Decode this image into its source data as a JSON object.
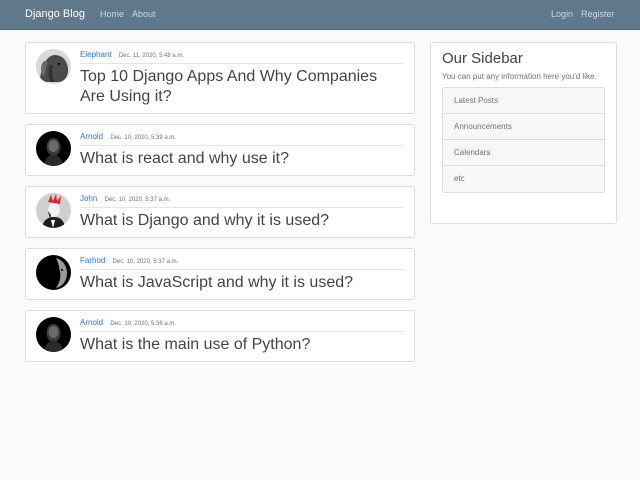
{
  "navbar": {
    "brand": "Django Blog",
    "links": [
      "Home",
      "About"
    ],
    "right_links": [
      "Login",
      "Register"
    ],
    "background": "#5f788a"
  },
  "posts": [
    {
      "author": "Elephant",
      "date": "Dec. 11, 2020, 5:48 a.m.",
      "title": "Top 10 Django Apps And Why Companies Are Using it?",
      "avatar_icon": "elephant-avatar-icon"
    },
    {
      "author": "Arnold",
      "date": "Dec. 10, 2020, 5:39 a.m.",
      "title": "What is react and why use it?",
      "avatar_icon": "dark-portrait-avatar-icon"
    },
    {
      "author": "John",
      "date": "Dec. 10, 2020, 5:37 a.m.",
      "title": "What is Django and why it is used?",
      "avatar_icon": "red-hair-avatar-icon"
    },
    {
      "author": "Farhod",
      "date": "Dec. 10, 2020, 5:37 a.m.",
      "title": "What is JavaScript and why it is used?",
      "avatar_icon": "half-face-avatar-icon"
    },
    {
      "author": "Arnold",
      "date": "Dec. 10, 2020, 5:36 a.m.",
      "title": "What is the main use of Python?",
      "avatar_icon": "dark-portrait-avatar-icon"
    }
  ],
  "sidebar": {
    "title": "Our Sidebar",
    "text": "You can put any information here you'd like.",
    "items": [
      "Latest Posts",
      "Announcements",
      "Calendars",
      "etc"
    ]
  },
  "colors": {
    "link": "#2a7ae2",
    "muted": "#6c757d",
    "page_background": "#fafafa"
  }
}
